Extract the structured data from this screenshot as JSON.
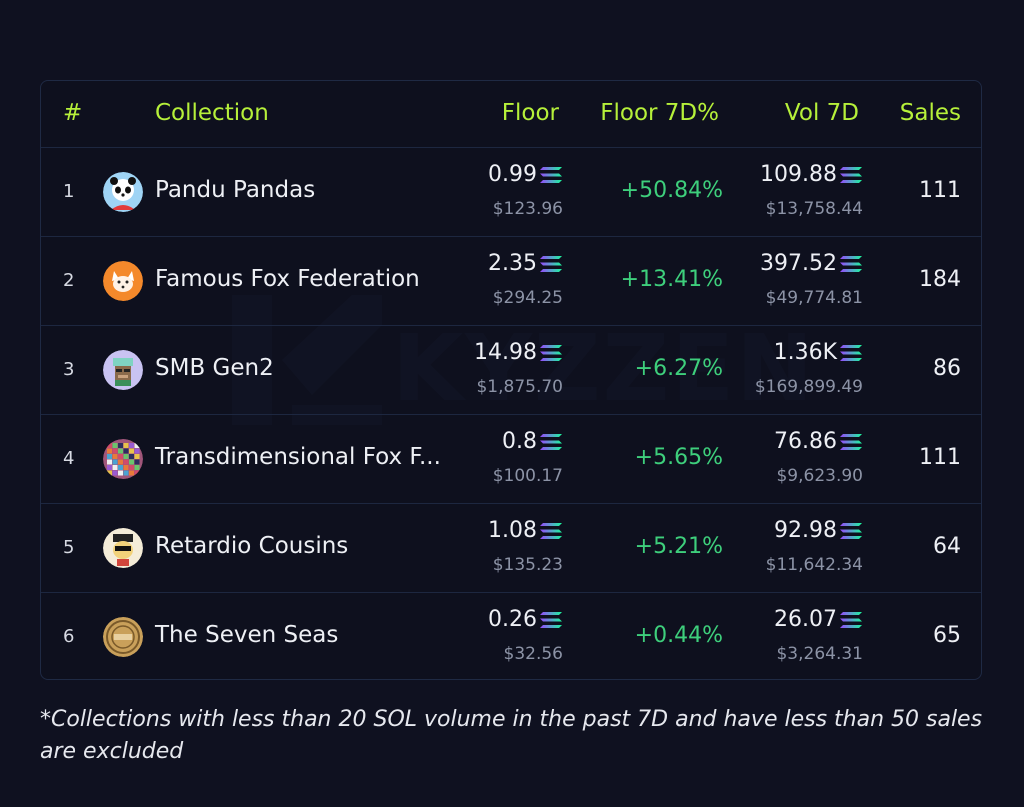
{
  "watermark": {
    "text": "KYZZEN"
  },
  "header": {
    "rank": "#",
    "collection": "Collection",
    "floor": "Floor",
    "floor_7d_pct": "Floor 7D%",
    "vol_7d": "Vol 7D",
    "sales": "Sales"
  },
  "rows": [
    {
      "rank": "1",
      "name": "Pandu Pandas",
      "avatar_icon": "panda-avatar-icon",
      "floor": "0.99",
      "floor_usd": "$123.96",
      "floor_7d_pct": "+50.84%",
      "vol_7d": "109.88",
      "vol_7d_usd": "$13,758.44",
      "sales": "111"
    },
    {
      "rank": "2",
      "name": "Famous Fox Federation",
      "avatar_icon": "fox-avatar-icon",
      "floor": "2.35",
      "floor_usd": "$294.25",
      "floor_7d_pct": "+13.41%",
      "vol_7d": "397.52",
      "vol_7d_usd": "$49,774.81",
      "sales": "184"
    },
    {
      "rank": "3",
      "name": "SMB Gen2",
      "avatar_icon": "monkey-avatar-icon",
      "floor": "14.98",
      "floor_usd": "$1,875.70",
      "floor_7d_pct": "+6.27%",
      "vol_7d": "1.36K",
      "vol_7d_usd": "$169,899.49",
      "sales": "86"
    },
    {
      "rank": "4",
      "name": "Transdimensional Fox F...",
      "avatar_icon": "mosaic-avatar-icon",
      "floor": "0.8",
      "floor_usd": "$100.17",
      "floor_7d_pct": "+5.65%",
      "vol_7d": "76.86",
      "vol_7d_usd": "$9,623.90",
      "sales": "111"
    },
    {
      "rank": "5",
      "name": "Retardio Cousins",
      "avatar_icon": "character-avatar-icon",
      "floor": "1.08",
      "floor_usd": "$135.23",
      "floor_7d_pct": "+5.21%",
      "vol_7d": "92.98",
      "vol_7d_usd": "$11,642.34",
      "sales": "64"
    },
    {
      "rank": "6",
      "name": "The Seven Seas",
      "avatar_icon": "coin-avatar-icon",
      "floor": "0.26",
      "floor_usd": "$32.56",
      "floor_7d_pct": "+0.44%",
      "vol_7d": "26.07",
      "vol_7d_usd": "$3,264.31",
      "sales": "65"
    }
  ],
  "footnote": "*Collections with less than 20 SOL volume in the past 7D and have less than 50 sales are excluded",
  "colors": {
    "accent": "#b6f03a",
    "positive": "#3ecf7c",
    "background": "#0f1120"
  },
  "currency_icon": "solana-icon"
}
